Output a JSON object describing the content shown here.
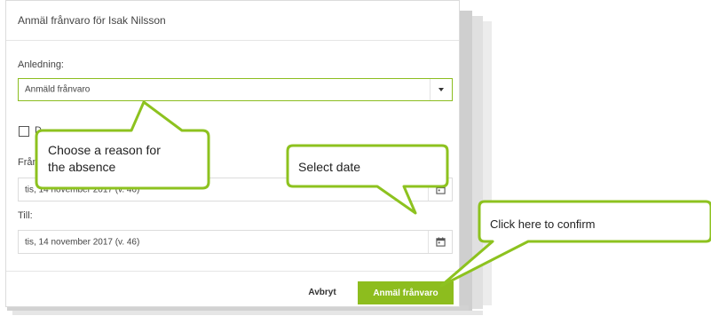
{
  "dialog": {
    "title": "Anmäl frånvaro för Isak Nilsson",
    "reason_label": "Anledning:",
    "reason_value": "Anmäld frånvaro",
    "checkbox_label": "D",
    "from_label": "Från",
    "from_value": "tis, 14 november 2017 (v. 46)",
    "to_label": "Till:",
    "to_value": "tis, 14 november 2017 (v. 46)",
    "cancel_label": "Avbryt",
    "confirm_label": "Anmäl frånvaro"
  },
  "callouts": {
    "reason_line1": "Choose a reason for",
    "reason_line2": "the absence",
    "date": "Select date",
    "confirm": "Click here to confirm"
  },
  "colors": {
    "accent": "#8dbd1e",
    "callout_border": "#8dc21f"
  },
  "icons": [
    "chevron-down-icon",
    "calendar-icon"
  ]
}
